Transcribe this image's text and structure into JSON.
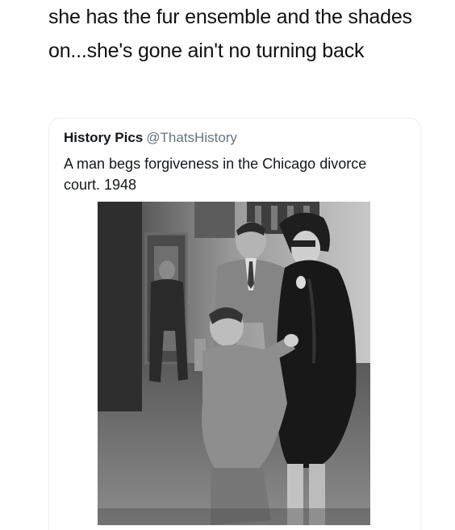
{
  "post": {
    "text": "she has the fur ensemble and the shades on...she's gone ain't no turning back"
  },
  "quoted_tweet": {
    "author": "History Pics",
    "handle": "@ThatsHistory",
    "text": "A man begs forgiveness in the Chicago divorce court. 1948"
  },
  "colors": {
    "text": "#111111",
    "handle": "#66757f",
    "card_border": "#eceff1"
  }
}
